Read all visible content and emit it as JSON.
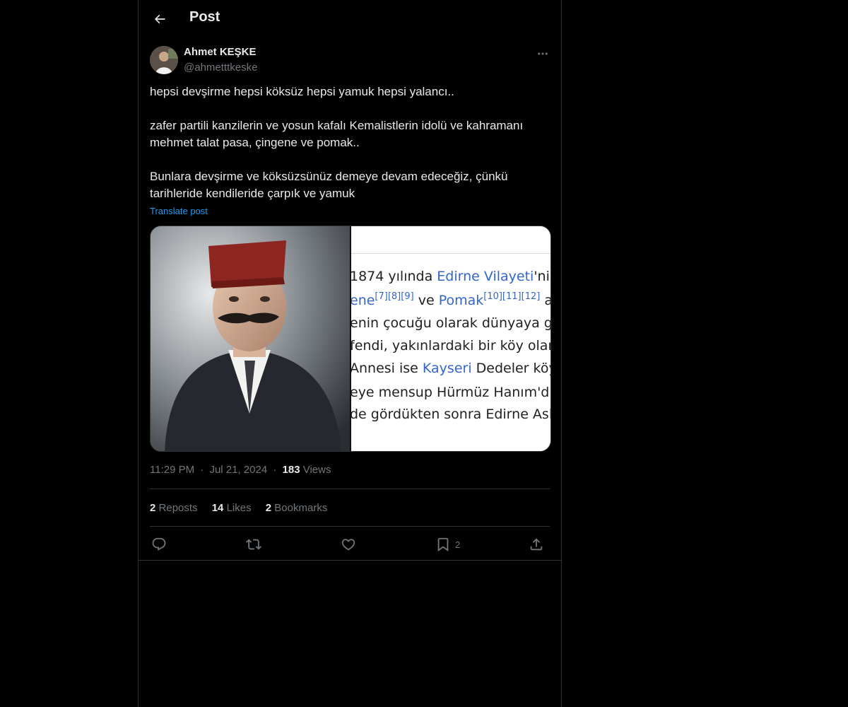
{
  "header": {
    "title": "Post"
  },
  "author": {
    "name": "Ahmet KEŞKE",
    "handle": "@ahmetttkeske"
  },
  "tweet": {
    "paragraphs": [
      "hepsi devşirme hepsi köksüz hepsi yamuk hepsi yalancı..",
      "zafer partili kanzilerin ve yosun kafalı Kemalistlerin idolü ve kahramanı mehmet talat pasa, çingene ve pomak..",
      "Bunlara devşirme ve köksüzsünüz demeye devam edeceğiz, çünkü tarihleride kendileride çarpık ve yamuk"
    ],
    "translate_label": "Translate post"
  },
  "media": {
    "wiki_lines": {
      "l1_a": "1874 yılında ",
      "l1_link": "Edirne Vilayeti",
      "l1_b": "'nin",
      "l2_link1": "ene",
      "l2_sup1": "[7][8][9]",
      "l2_mid": " ve ",
      "l2_link2": "Pomak",
      "l2_sup2": "[10][11][12]",
      "l2_end": " a",
      "l3": "enin çocuğu olarak dünyaya geld",
      "l4": "fendi, yakınlardaki bir köy olan",
      "l5_a": "Annesi ise ",
      "l5_link": "Kayseri",
      "l5_b": " Dedeler köyü",
      "l6_a": "eye mensup Hürmüz Hanım'dı.",
      "l6_sup": "[",
      "l7": "de gördükten sonra Edirne Aske"
    }
  },
  "meta": {
    "time": "11:29 PM",
    "sep1": "·",
    "date": "Jul 21, 2024",
    "sep2": "·",
    "views_count": "183",
    "views_label": "Views"
  },
  "stats": {
    "reposts_count": "2",
    "reposts_label": "Reposts",
    "likes_count": "14",
    "likes_label": "Likes",
    "bookmarks_count": "2",
    "bookmarks_label": "Bookmarks"
  },
  "actions": {
    "bookmark_count": "2"
  },
  "icons": [
    "back-arrow-icon",
    "more-icon",
    "reply-icon",
    "repost-icon",
    "like-icon",
    "bookmark-icon",
    "share-icon"
  ],
  "colors": {
    "background": "#000000",
    "text": "#e7e9ea",
    "muted": "#71767b",
    "link": "#1d9bf0",
    "border": "#2f3336"
  }
}
